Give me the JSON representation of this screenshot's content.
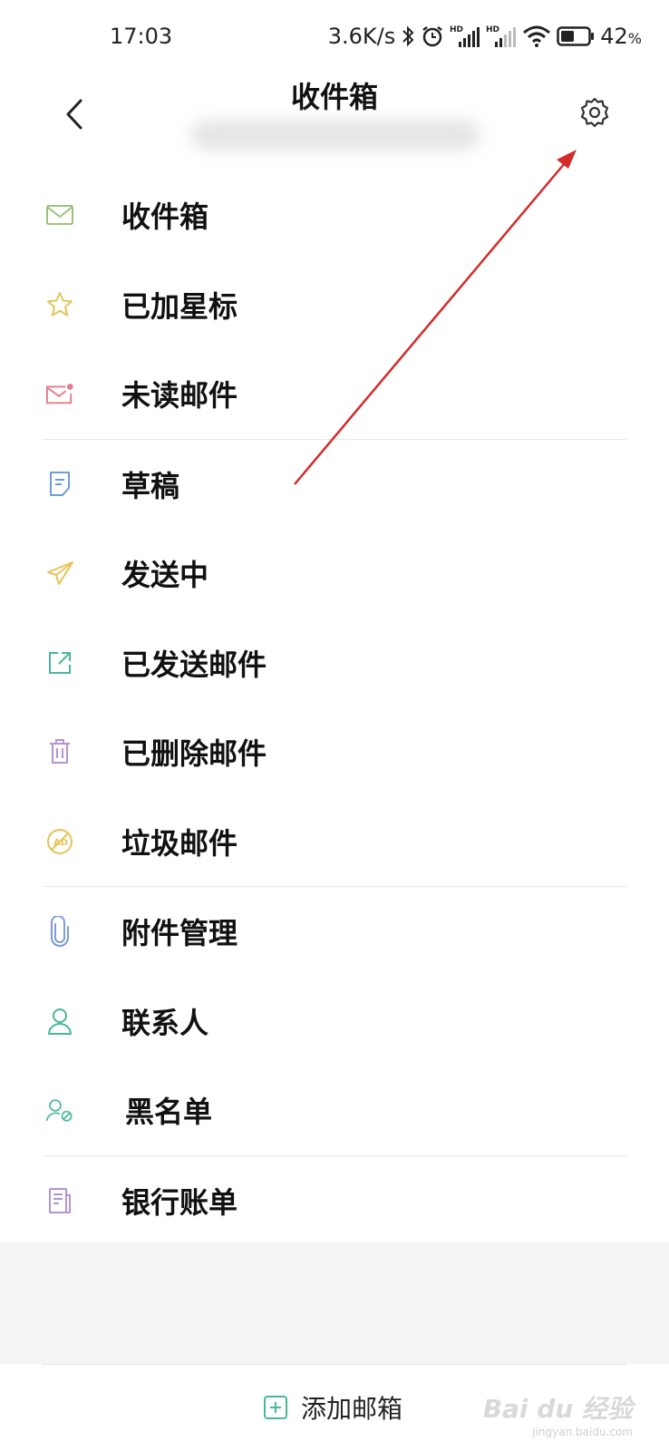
{
  "status_bar": {
    "time": "17:03",
    "net_speed": "3.6K/s",
    "battery_percent": "42",
    "battery_unit": "%"
  },
  "header": {
    "title": "收件箱"
  },
  "menu": {
    "items": [
      {
        "label": "收件箱",
        "icon": "envelope-icon",
        "color": "#9bc47a"
      },
      {
        "label": "已加星标",
        "icon": "star-icon",
        "color": "#e7c45a"
      },
      {
        "label": "未读邮件",
        "icon": "unread-mail-icon",
        "color": "#e27a88"
      },
      {
        "label": "草稿",
        "icon": "draft-icon",
        "color": "#6a9ed8"
      },
      {
        "label": "发送中",
        "icon": "paper-plane-icon",
        "color": "#e7c45a"
      },
      {
        "label": "已发送邮件",
        "icon": "sent-external-icon",
        "color": "#48b89a"
      },
      {
        "label": "已删除邮件",
        "icon": "trash-icon",
        "color": "#b493d6"
      },
      {
        "label": "垃圾邮件",
        "icon": "spam-ad-icon",
        "color": "#e7c45a"
      },
      {
        "label": "附件管理",
        "icon": "paperclip-icon",
        "color": "#7c9bd8"
      },
      {
        "label": "联系人",
        "icon": "contact-icon",
        "color": "#48b89a"
      },
      {
        "label": "黑名单",
        "icon": "blocked-contact-icon",
        "color": "#48b89a"
      },
      {
        "label": "银行账单",
        "icon": "bank-bill-icon",
        "color": "#b493d6"
      }
    ]
  },
  "footer": {
    "add_mailbox_label": "添加邮箱"
  },
  "watermark": {
    "text": "Bai du 经验",
    "url": "jingyan.baidu.com"
  }
}
